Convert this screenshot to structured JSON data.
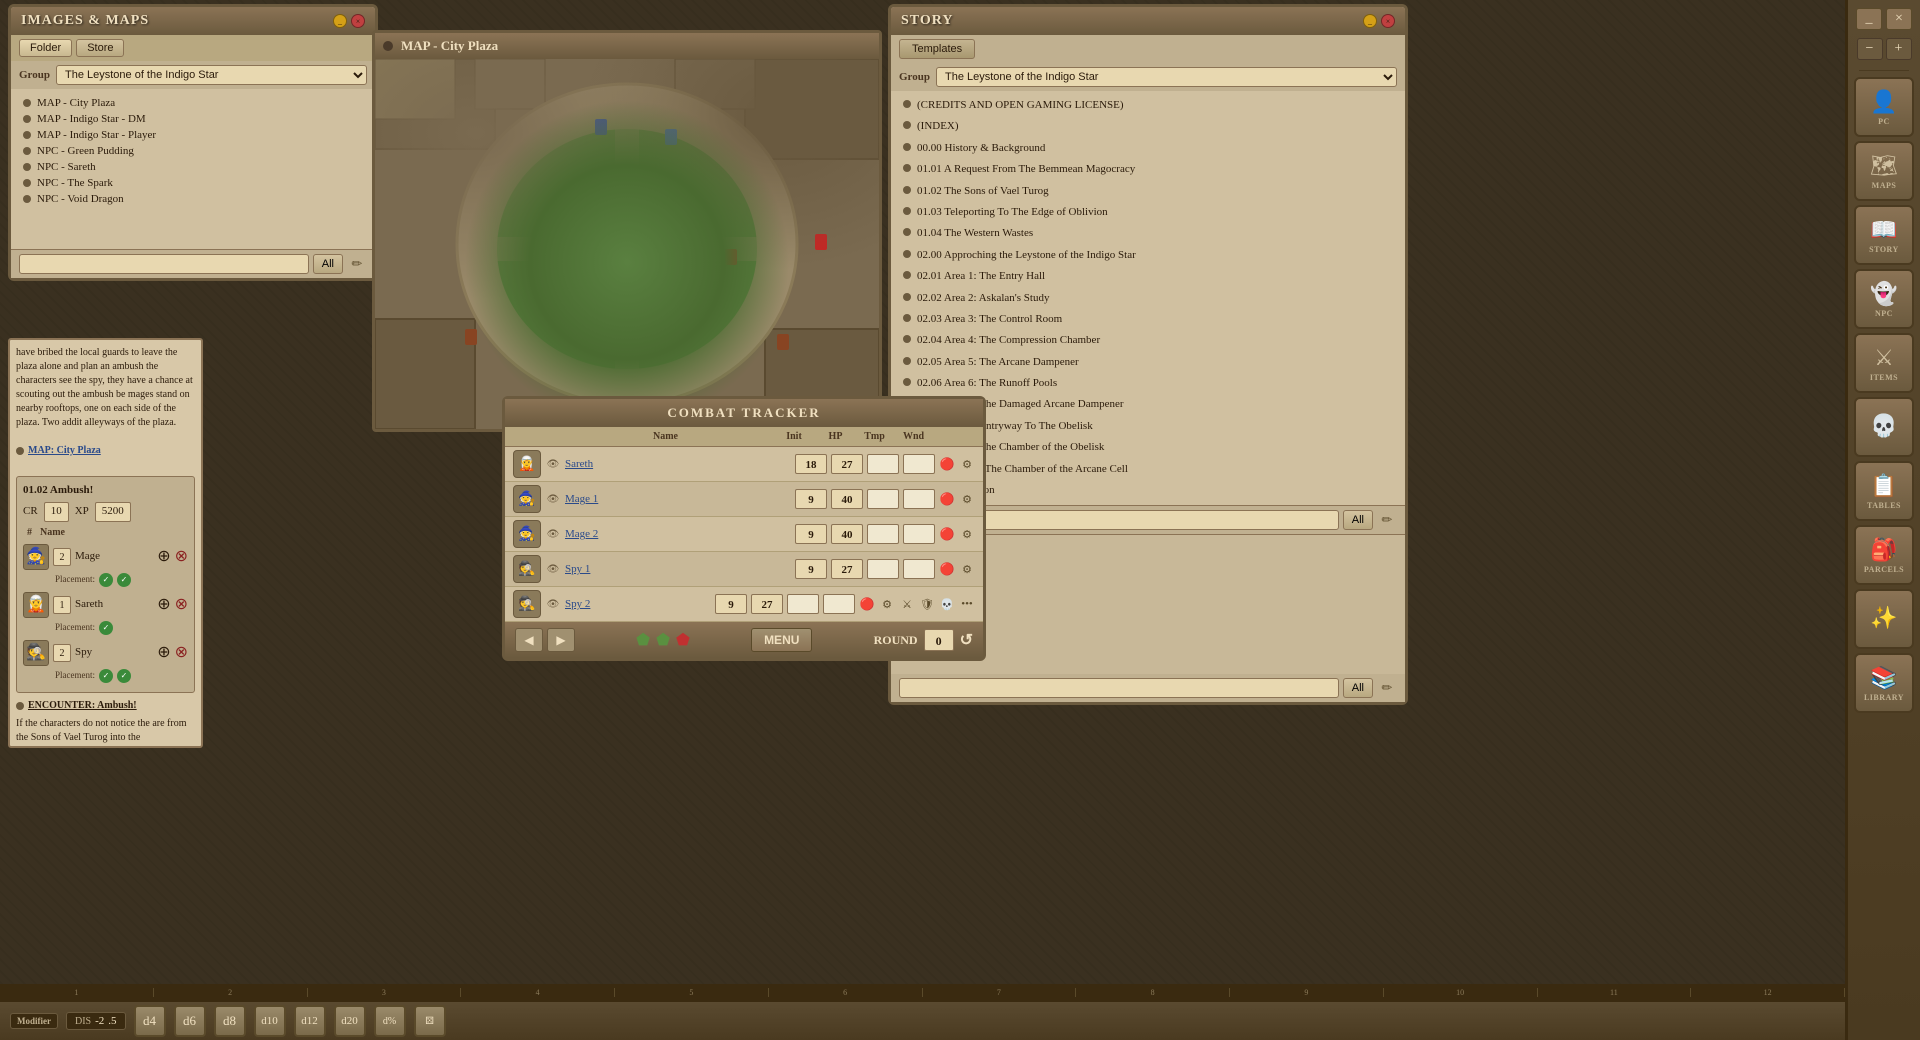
{
  "images_maps": {
    "title": "IMAGES & MAPS",
    "toolbar": {
      "folder": "Folder",
      "store": "Store"
    },
    "group_label": "Group",
    "group_value": "The Leystone of the Indigo Star",
    "items": [
      {
        "name": "MAP - City Plaza"
      },
      {
        "name": "MAP - Indigo Star - DM"
      },
      {
        "name": "MAP - Indigo Star - Player"
      },
      {
        "name": "NPC - Green Pudding"
      },
      {
        "name": "NPC - Sareth"
      },
      {
        "name": "NPC - The Spark"
      },
      {
        "name": "NPC - Void Dragon"
      }
    ],
    "search_placeholder": "",
    "all_btn": "All"
  },
  "map_window": {
    "title": "MAP - City Plaza"
  },
  "story_panel": {
    "title": "STORY",
    "templates_btn": "Templates",
    "group_label": "Group",
    "group_value": "The Leystone of the Indigo Star",
    "items": [
      {
        "text": "(CREDITS AND OPEN GAMING LICENSE)"
      },
      {
        "text": "(INDEX)"
      },
      {
        "text": "00.00 History & Background"
      },
      {
        "text": "01.01 A Request From The Bemmean Magocracy"
      },
      {
        "text": "01.02 The Sons of Vael Turog"
      },
      {
        "text": "01.03 Teleporting To The Edge of Oblivion"
      },
      {
        "text": "01.04 The Western Wastes"
      },
      {
        "text": "02.00 Approching the Leystone of the Indigo Star"
      },
      {
        "text": "02.01 Area 1: The Entry Hall"
      },
      {
        "text": "02.02 Area 2: Askalan's Study"
      },
      {
        "text": "02.03 Area 3: The Control Room"
      },
      {
        "text": "02.04 Area 4: The Compression Chamber"
      },
      {
        "text": "02.05 Area 5: The Arcane Dampener"
      },
      {
        "text": "02.06 Area 6: The Runoff Pools"
      },
      {
        "text": "02.07 Area 7: The Damaged Arcane Dampener"
      },
      {
        "text": "02.08 Area 8: Entryway To The Obelisk"
      },
      {
        "text": "02.09 Area 9: The Chamber of the Obelisk"
      },
      {
        "text": "02.10 Area 10: The Chamber of the Arcane Cell"
      },
      {
        "text": "03.00 Conclusion"
      }
    ],
    "all_btn": "All"
  },
  "combat_tracker": {
    "title": "COMBAT TRACKER",
    "columns": {
      "name": "Name",
      "init": "Init",
      "hp": "HP",
      "tmp": "Tmp",
      "wnd": "Wnd"
    },
    "combatants": [
      {
        "name": "Sareth",
        "init": 18,
        "hp": 27,
        "tmp": "",
        "wnd": "",
        "avatar": "🧝"
      },
      {
        "name": "Mage 1",
        "init": 9,
        "hp": 40,
        "tmp": "",
        "wnd": "",
        "avatar": "🧙"
      },
      {
        "name": "Mage 2",
        "init": 9,
        "hp": 40,
        "tmp": "",
        "wnd": "",
        "avatar": "🧙"
      },
      {
        "name": "Spy 1",
        "init": 9,
        "hp": 27,
        "tmp": "",
        "wnd": "",
        "avatar": "🕵"
      },
      {
        "name": "Spy 2",
        "init": 9,
        "hp": 27,
        "tmp": "",
        "wnd": "",
        "avatar": "🕵"
      }
    ],
    "round_label": "ROUND",
    "round_value": "0",
    "menu_btn": "MENU"
  },
  "encounter": {
    "title": "01.02 Ambush!",
    "cr_label": "CR",
    "cr_value": "10",
    "xp_label": "XP",
    "xp_value": "5200",
    "token_col_hash": "#",
    "token_col_name": "Name",
    "tokens": [
      {
        "avatar": "🧙",
        "count": "2",
        "name": "Mage",
        "placement1": true,
        "placement2": true
      },
      {
        "avatar": "🧝",
        "count": "1",
        "name": "Sareth",
        "placement1": true,
        "placement2": false
      },
      {
        "avatar": "🕵",
        "count": "2",
        "name": "Spy",
        "placement1": true,
        "placement2": true
      }
    ]
  },
  "story_text": {
    "content": "have bribed the local guards to leave the plaza alone and plan an ambush the characters see the spy, they have a chance at scouting out the ambush be mages stand on nearby rooftops, one on each side of the plaza. Two addit alleyways of the plaza.",
    "map_ref": "MAP: City Plaza",
    "encounter_ref": "ENCOUNTER: Ambush!",
    "desc": "If the characters do not notice the are from the Sons of Vael Turog into the interrogation, investiga to perform their own interroga"
  },
  "right_sidebar": {
    "icons": [
      {
        "symbol": "⊕",
        "label": ""
      },
      {
        "symbol": "−+",
        "label": ""
      },
      {
        "symbol": "👤",
        "label": "PC"
      },
      {
        "symbol": "🗺",
        "label": "MAPS"
      },
      {
        "symbol": "😈",
        "label": "STORY"
      },
      {
        "symbol": "👻",
        "label": "NPC"
      },
      {
        "symbol": "⚔",
        "label": "ITEMS"
      },
      {
        "symbol": "💢",
        "label": ""
      },
      {
        "symbol": "📋",
        "label": "TABLES"
      },
      {
        "symbol": "🎒",
        "label": "PARCELS"
      },
      {
        "symbol": "🔄",
        "label": ""
      },
      {
        "symbol": "📚",
        "label": "LIBRARY"
      }
    ]
  },
  "dice_bar": {
    "modifier_label": "Modifier",
    "dis_label": "DIS",
    "dis_value": "-2",
    "dot_value": ".5",
    "dice": [
      "d4",
      "d6",
      "d8",
      "d10",
      "d12",
      "d20",
      "d100"
    ]
  },
  "ruler": {
    "marks": [
      "1",
      "2",
      "3",
      "4",
      "5",
      "6",
      "7",
      "8",
      "9",
      "10",
      "11",
      "12"
    ]
  }
}
